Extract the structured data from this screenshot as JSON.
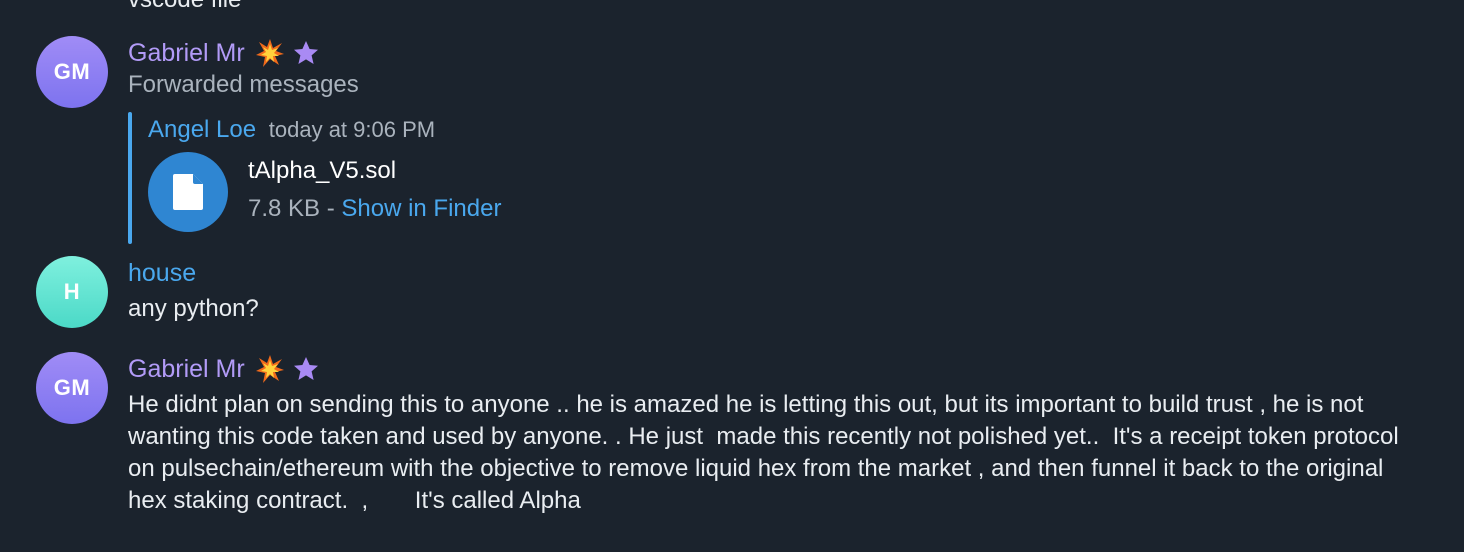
{
  "top_cut_text": "vscode  file",
  "messages": [
    {
      "avatar_initials": "GM",
      "sender": "Gabriel Mr",
      "badges": [
        "collision-emoji",
        "star-emoji"
      ],
      "subtitle": "Forwarded messages",
      "forwarded": {
        "author": "Angel Loe",
        "time": "today at 9:06 PM",
        "file": {
          "name": "tAlpha_V5.sol",
          "size": "7.8 KB",
          "separator": " - ",
          "action": "Show in Finder"
        }
      }
    },
    {
      "avatar_initials": "H",
      "sender": "house",
      "text": "any python?"
    },
    {
      "avatar_initials": "GM",
      "sender": "Gabriel Mr",
      "badges": [
        "collision-emoji",
        "star-emoji"
      ],
      "text": "He didnt plan on sending this to anyone .. he is amazed he is letting this out, but its important to build trust , he is not wanting this code taken and used by anyone. . He just  made this recently not polished yet..  It's a receipt token protocol on pulsechain/ethereum with the objective to remove liquid hex from the market , and then funnel it back to the original hex staking contract.  ,       It's called Alpha"
    }
  ],
  "colors": {
    "background": "#1b232d",
    "purple_name": "#b29bf7",
    "blue_accent": "#4aa8ee",
    "text": "#e9edf1",
    "muted": "#aab3bd"
  }
}
